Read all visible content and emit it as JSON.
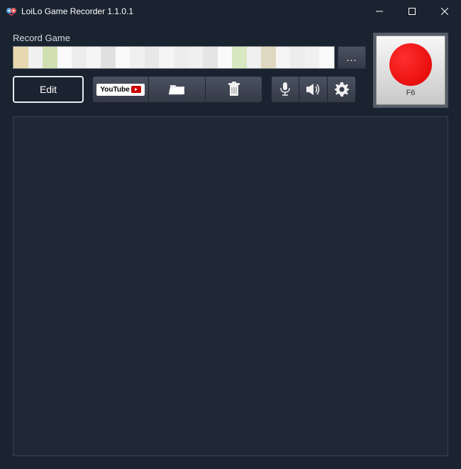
{
  "window": {
    "title": "LoiLo Game Recorder 1.1.0.1"
  },
  "main": {
    "record_label": "Record Game",
    "browse_label": "...",
    "edit_label": "Edit",
    "youtube_label": "YouTube"
  },
  "record_button": {
    "hotkey": "F6"
  }
}
